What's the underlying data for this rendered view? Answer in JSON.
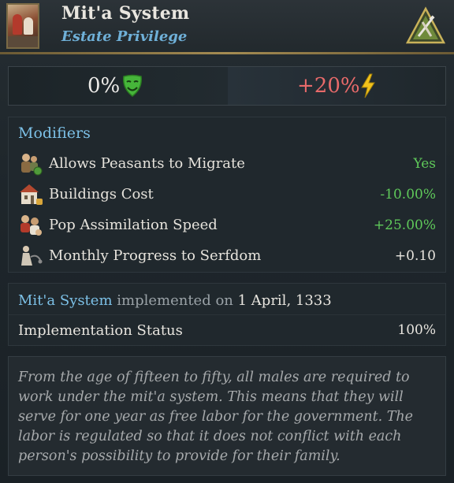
{
  "header": {
    "title": "Mit'a System",
    "subtitle": "Estate Privilege",
    "portrait_icon": "estate-portrait-icon",
    "estate_icon": "peasant-estate-triangle-icon"
  },
  "stats": {
    "left_value": "0%",
    "left_icon": "green-mask-icon",
    "right_value": "+20%",
    "right_icon": "lightning-bolt-icon"
  },
  "modifiers": {
    "heading": "Modifiers",
    "rows": [
      {
        "label": "Allows Peasants to Migrate",
        "value": "Yes",
        "icon": "peasants-migrate-icon",
        "color": "#5fc95a"
      },
      {
        "label": "Buildings Cost",
        "value": "-10.00%",
        "icon": "building-icon",
        "color": "#5fc95a"
      },
      {
        "label": "Pop Assimilation Speed",
        "value": "+25.00%",
        "icon": "pop-assimilation-icon",
        "color": "#5fc95a"
      },
      {
        "label": "Monthly Progress to Serfdom",
        "value": "+0.10",
        "icon": "serfdom-icon",
        "color": "#e8e5df"
      }
    ]
  },
  "implementation": {
    "name": "Mit'a System",
    "verb": "implemented on",
    "date": "1 April, 1333",
    "status_label": "Implementation Status",
    "status_value": "100%"
  },
  "description": "From the age of fifteen to fifty, all males are required to work under the mit'a system. This means that they will serve for one year as free labor for the government. The labor is regulated so that it does not conflict with each person's possibility to provide for their family.",
  "colors": {
    "accent_blue": "#7cc0e6",
    "positive_green": "#5fc95a",
    "negative_red": "#e86a6a",
    "gold_rule": "#a48b52"
  }
}
